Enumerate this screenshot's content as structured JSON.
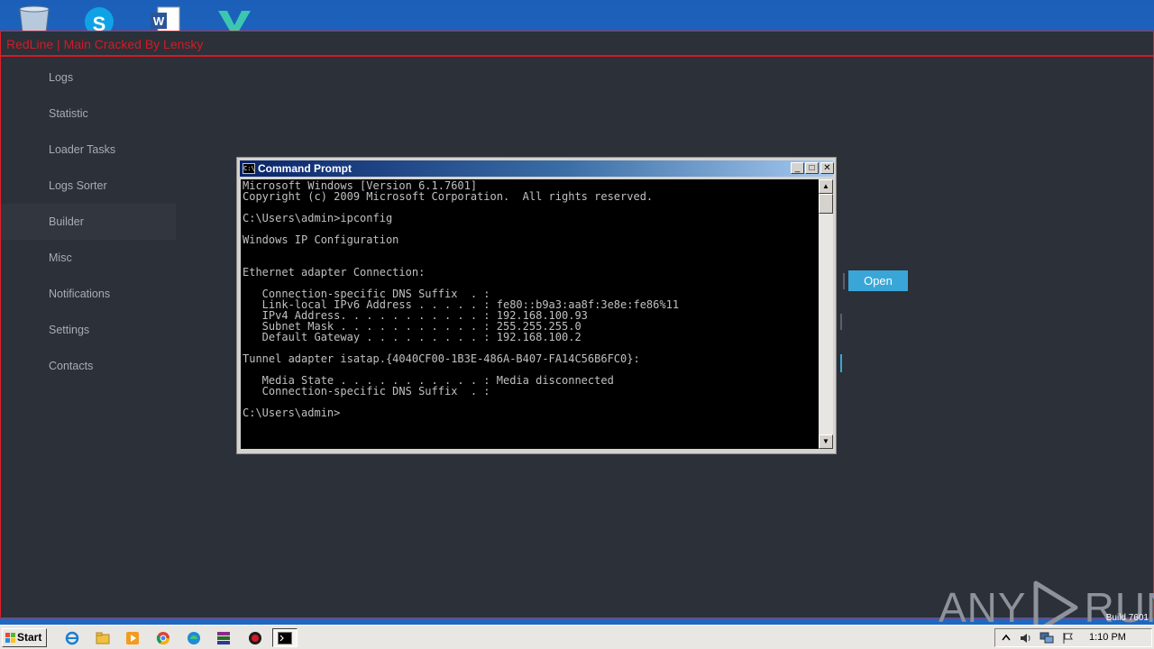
{
  "desktop": {
    "icons": [
      "recycle-bin-icon",
      "skype-icon",
      "word-icon",
      "v-app-icon"
    ]
  },
  "app": {
    "title": "RedLine | Main Cracked By Lensky",
    "nav": [
      {
        "label": "Logs"
      },
      {
        "label": "Statistic"
      },
      {
        "label": "Loader Tasks"
      },
      {
        "label": "Logs Sorter"
      },
      {
        "label": "Builder"
      },
      {
        "label": "Misc"
      },
      {
        "label": "Notifications"
      },
      {
        "label": "Settings"
      },
      {
        "label": "Contacts"
      }
    ],
    "active_nav": "Builder",
    "open_button": "Open",
    "accent_color": "#3aa6d8",
    "title_color": "#d41a24"
  },
  "cmd": {
    "title": "Command Prompt",
    "icon_text": "C:\\",
    "controls": {
      "minimize": "_",
      "maximize": "□",
      "close": "✕"
    },
    "output": "Microsoft Windows [Version 6.1.7601]\nCopyright (c) 2009 Microsoft Corporation.  All rights reserved.\n\nC:\\Users\\admin>ipconfig\n\nWindows IP Configuration\n\n\nEthernet adapter Connection:\n\n   Connection-specific DNS Suffix  . :\n   Link-local IPv6 Address . . . . . : fe80::b9a3:aa8f:3e8e:fe86%11\n   IPv4 Address. . . . . . . . . . . : 192.168.100.93\n   Subnet Mask . . . . . . . . . . . : 255.255.255.0\n   Default Gateway . . . . . . . . . : 192.168.100.2\n\nTunnel adapter isatap.{4040CF00-1B3E-486A-B407-FA14C56B6FC0}:\n\n   Media State . . . . . . . . . . . : Media disconnected\n   Connection-specific DNS Suffix  . :\n\nC:\\Users\\admin>"
  },
  "watermark": {
    "left": "ANY",
    "right": "RUN"
  },
  "taskbar": {
    "start_label": "Start",
    "build": "Build 7601",
    "time": "1:10 PM",
    "items": [
      "ie-icon",
      "explorer-icon",
      "media-player-icon",
      "chrome-icon",
      "edge-icon",
      "winrar-icon",
      "redline-icon",
      "cmd-icon"
    ],
    "tray": [
      "show-hidden-icon",
      "volume-icon",
      "network-icon",
      "action-center-flag-icon"
    ]
  }
}
